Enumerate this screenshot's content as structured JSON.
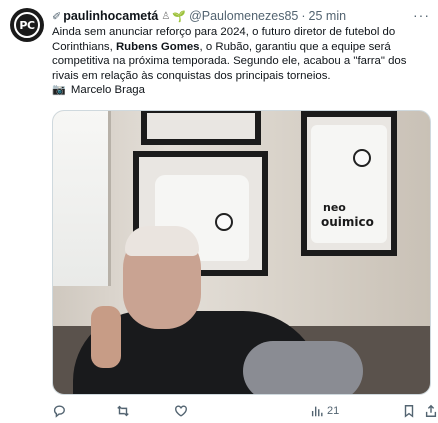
{
  "tweet": {
    "avatar_text": "PC",
    "badge_glyph": "✐",
    "author_name": "paulinhocametá",
    "verified_glyph": "♙",
    "seedling_glyph": "🌱",
    "handle": "@Paulomenezes85",
    "separator": "·",
    "time": "25 min",
    "more_glyph": "···",
    "text_lines": [
      "Ainda sem anunciar reforço para 2024, o futuro diretor de futebol do",
      "competitiva na próxima temporada. Segundo ele, acabou a \"farra\" dos",
      "rivais em relação às conquistas dos principais torneios."
    ],
    "line2_part1": "Corinthians, ",
    "line2_bold": "Rubens Gomes",
    "line2_part2": ", o Rubão, garantiu que a equipe será",
    "camera_glyph": "📷",
    "photo_credit": "Marcelo Braga",
    "media_text": {
      "sponsor_small": "neo",
      "sponsor_large": "ouimico"
    },
    "actions": {
      "views_count": "21"
    }
  },
  "colors": {
    "text": "#0f1419",
    "secondary": "#536471",
    "border": "#cfd9de"
  }
}
